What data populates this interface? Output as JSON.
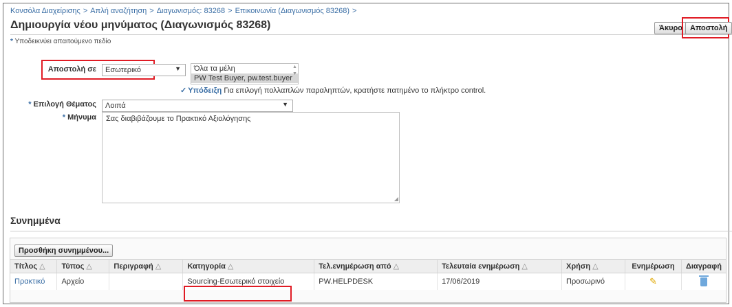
{
  "breadcrumb": [
    "Κονσόλα Διαχείρισης",
    "Απλή αναζήτηση",
    "Διαγωνισμός: 83268",
    "Επικοινωνία (Διαγωνισμός 83268)"
  ],
  "breadcrumb_sep": ">",
  "page_title": "Δημιουργία νέου μηνύματος (Διαγωνισμός 83268)",
  "buttons": {
    "cancel": "Άκυρο",
    "send": "Αποστολή"
  },
  "required_hint": "Υποδεικνύει απαιτούμενο πεδίο",
  "form": {
    "send_to_label": "Αποστολή σε",
    "send_to_value": "Εσωτερικό",
    "recipients": [
      "Όλα τα μέλη",
      "PW Test Buyer, pw.test.buyer"
    ],
    "tip_label": "Υπόδειξη",
    "tip_text": "Για επιλογή πολλαπλών παραληπτών, κρατήστε πατημένο το πλήκτρο control.",
    "subject_label": "Επιλογή Θέματος",
    "subject_value": "Λοιπά",
    "message_label": "Μήνυμα",
    "message_value": "Σας διαβιβάζουμε το Πρακτικό Αξιολόγησης"
  },
  "attachments": {
    "title": "Συνημμένα",
    "add_button": "Προσθήκη συνημμένου...",
    "columns": [
      "Τίτλος",
      "Τύπος",
      "Περιγραφή",
      "Κατηγορία",
      "Τελ.ενημέρωση από",
      "Τελευταία ενημέρωση",
      "Χρήση",
      "Ενημέρωση",
      "Διαγραφή"
    ],
    "rows": [
      {
        "title": "Πρακτικό",
        "type": "Αρχείο",
        "description": "",
        "category": "Sourcing-Εσωτερικό στοιχείο",
        "updated_by": "PW.HELPDESK",
        "last_updated": "17/06/2019",
        "usage": "Προσωρινό"
      }
    ]
  },
  "colors": {
    "link": "#3a6ea5",
    "highlight": "#e01b24",
    "pencil": "#e0a800",
    "trash": "#6fa8dc"
  },
  "icons": {
    "update": "pencil-icon",
    "delete": "trash-icon",
    "tip": "check-icon",
    "sort": "sort-icon"
  }
}
